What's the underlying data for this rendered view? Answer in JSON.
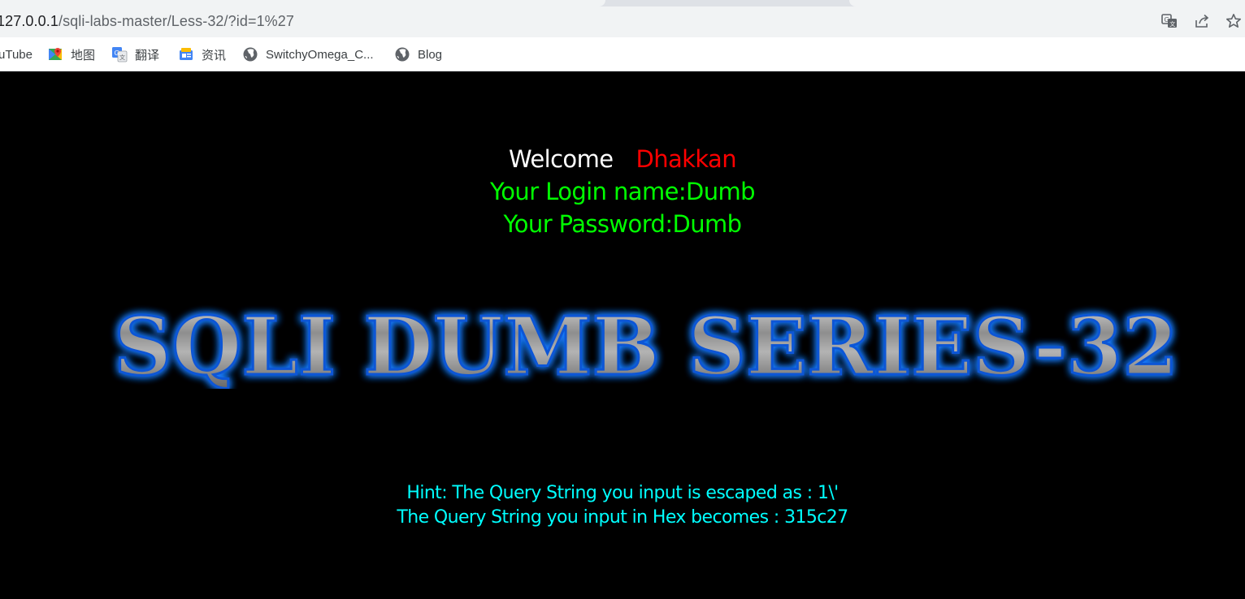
{
  "browser": {
    "url_host": "127.0.0.1",
    "url_path": "/sqli-labs-master/Less-32/?id=1%27",
    "icons": [
      "translate-icon",
      "share-icon",
      "bookmark-star-icon"
    ],
    "bookmarks": [
      {
        "label": "uTube",
        "icon": "youtube-icon"
      },
      {
        "label": "地图",
        "icon": "maps-icon"
      },
      {
        "label": "翻译",
        "icon": "translate-icon"
      },
      {
        "label": "资讯",
        "icon": "news-icon"
      },
      {
        "label": "SwitchyOmega_C...",
        "icon": "globe-icon"
      },
      {
        "label": "Blog",
        "icon": "globe-icon"
      }
    ]
  },
  "page": {
    "welcome": "Welcome",
    "user": "Dhakkan",
    "login_line": "Your Login name:Dumb",
    "password_line": "Your Password:Dumb",
    "banner": "SQLI DUMB SERIES-32",
    "hint_escaped": "Hint: The Query String you input is escaped as : 1\\'",
    "hint_hex": "The Query String you input in Hex becomes : 315c27",
    "colors": {
      "background": "#000000",
      "welcome": "#ffffff",
      "user": "#ff0000",
      "credentials": "#00ff00",
      "hint": "#00ffff",
      "banner_glow": "#1a7cff"
    }
  }
}
